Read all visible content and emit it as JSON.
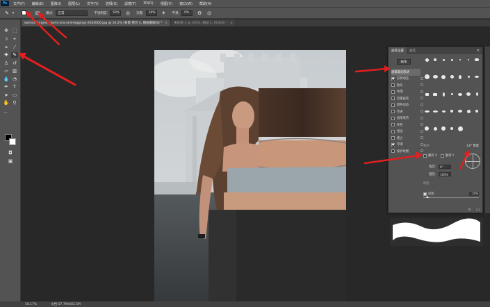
{
  "app": {
    "logo": "Ps"
  },
  "menu": [
    "文件(F)",
    "编辑(E)",
    "图像(I)",
    "图层(L)",
    "文字(Y)",
    "选择(S)",
    "滤镜(T)",
    "3D(D)",
    "视图(V)",
    "窗口(W)",
    "帮助(H)"
  ],
  "options": {
    "mode_label": "模式:",
    "mode_value": "正常",
    "opacity_label": "不透明度:",
    "opacity_value": "50%",
    "flow_label": "流量:",
    "flow_value": "30%",
    "smoothing_label": "平滑:",
    "smoothing_value": "0%"
  },
  "tabs": [
    {
      "label": "woman-in-grey-sports-bra-and-leggings-2644000.jpg @ 16.2% (背景 拷贝 4, 图层蒙版/8) *",
      "active": true
    },
    {
      "label": "未标题-1 @ 100% (图层 1, RGB/8) *",
      "active": false
    }
  ],
  "status": {
    "zoom": "16.17%",
    "doc": "文档:57.7M/402.5M"
  },
  "brush_panel": {
    "tabs": [
      "画笔设置",
      "画笔"
    ],
    "preset_button": "画笔",
    "selected_item": "画笔笔尖形状",
    "items": [
      {
        "label": "画笔笔尖形状",
        "checked": false,
        "selected": true
      },
      {
        "label": "形状动态",
        "checked": true
      },
      {
        "label": "散布",
        "checked": false
      },
      {
        "label": "纹理",
        "checked": false
      },
      {
        "label": "双重画笔",
        "checked": false
      },
      {
        "label": "颜色动态",
        "checked": false
      },
      {
        "label": "传递",
        "checked": false
      },
      {
        "label": "画笔笔势",
        "checked": false
      },
      {
        "label": "杂色",
        "checked": false
      },
      {
        "label": "湿边",
        "checked": false
      },
      {
        "label": "建立",
        "checked": false
      },
      {
        "label": "平滑",
        "checked": true
      },
      {
        "label": "保护纹理",
        "checked": false
      }
    ],
    "size_label": "大小",
    "size_value": "137 像素",
    "flip_x": "翻转 X",
    "flip_y": "翻转 Y",
    "angle_label": "角度:",
    "angle_value": "0°",
    "roundness_label": "圆度:",
    "roundness_value": "100%",
    "hardness_label": "硬度",
    "spacing_label": "间距",
    "spacing_value": "10%"
  }
}
